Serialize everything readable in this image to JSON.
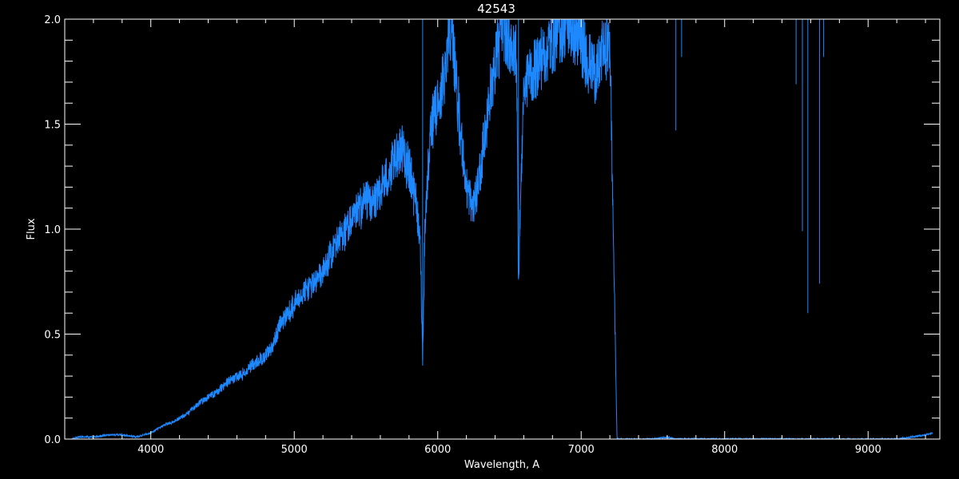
{
  "chart_data": {
    "type": "line",
    "title": "42543",
    "xlabel": "Wavelength, A",
    "ylabel": "Flux",
    "xlim": [
      3400,
      9500
    ],
    "ylim": [
      0,
      2
    ],
    "grid": false,
    "x_ticks": [
      4000,
      5000,
      6000,
      7000,
      8000,
      9000
    ],
    "x_tick_labels": [
      "4000",
      "5000",
      "6000",
      "7000",
      "8000",
      "9000"
    ],
    "y_ticks": [
      0,
      0.5,
      1.0,
      1.5,
      2.0
    ],
    "y_tick_labels": [
      "0.0",
      "0.5",
      "1.0",
      "1.5",
      "2.0"
    ],
    "colors": {
      "background": "#000000",
      "axes": "#ffffff",
      "series": "#1e88ff"
    },
    "series": [
      {
        "name": "",
        "x": [
          3450,
          3500,
          3600,
          3700,
          3800,
          3900,
          4000,
          4050,
          4100,
          4150,
          4200,
          4250,
          4300,
          4350,
          4400,
          4450,
          4500,
          4550,
          4600,
          4650,
          4700,
          4750,
          4800,
          4850,
          4900,
          4950,
          5000,
          5050,
          5100,
          5150,
          5200,
          5250,
          5300,
          5350,
          5400,
          5450,
          5500,
          5550,
          5600,
          5650,
          5700,
          5750,
          5800,
          5850,
          5880,
          5895,
          5910,
          5950,
          6000,
          6050,
          6080,
          6100,
          6150,
          6200,
          6250,
          6300,
          6350,
          6400,
          6450,
          6500,
          6550,
          6563,
          6600,
          6650,
          6700,
          6750,
          6800,
          6850,
          6900,
          6950,
          7000,
          7050,
          7100,
          7150,
          7200,
          7250,
          7300,
          7400,
          7500,
          7600,
          7650,
          7700,
          7800,
          7900,
          8000,
          8100,
          8200,
          8300,
          8400,
          8450,
          8500,
          8542,
          8600,
          8662,
          8700,
          8800,
          8900,
          9000,
          9100,
          9200,
          9300,
          9400,
          9450
        ],
        "y": [
          0.0,
          0.01,
          0.01,
          0.02,
          0.02,
          0.01,
          0.03,
          0.05,
          0.07,
          0.08,
          0.1,
          0.12,
          0.15,
          0.18,
          0.2,
          0.22,
          0.25,
          0.28,
          0.3,
          0.32,
          0.35,
          0.38,
          0.4,
          0.45,
          0.55,
          0.6,
          0.65,
          0.7,
          0.72,
          0.75,
          0.8,
          0.88,
          0.95,
          1.0,
          1.05,
          1.1,
          1.15,
          1.12,
          1.2,
          1.25,
          1.35,
          1.4,
          1.3,
          1.15,
          0.9,
          0.38,
          1.0,
          1.5,
          1.6,
          1.75,
          2.0,
          1.95,
          1.55,
          1.2,
          1.1,
          1.3,
          1.6,
          1.8,
          2.0,
          1.9,
          1.85,
          0.76,
          1.7,
          1.75,
          1.8,
          1.85,
          1.9,
          1.95,
          2.0,
          1.95,
          1.9,
          1.8,
          1.75,
          1.85,
          1.9,
          0.0,
          0.0,
          0.0,
          0.0,
          0.01,
          0.0,
          0.0,
          0.0,
          0.0,
          0.0,
          0.0,
          0.0,
          0.0,
          0.0,
          0.0,
          0.0,
          0.0,
          0.0,
          0.0,
          0.0,
          0.0,
          0.0,
          0.0,
          0.0,
          0.0,
          0.01,
          0.02,
          0.03
        ]
      }
    ],
    "absorption_lines": [
      {
        "x": 5895,
        "ymin": 0.38
      },
      {
        "x": 6563,
        "ymin": 0.76
      },
      {
        "x": 7660,
        "ymin": 1.47
      },
      {
        "x": 7700,
        "ymin": 1.82
      },
      {
        "x": 8498,
        "ymin": 1.69
      },
      {
        "x": 8542,
        "ymin": 0.99
      },
      {
        "x": 8580,
        "ymin": 0.6
      },
      {
        "x": 8662,
        "ymin": 0.74
      },
      {
        "x": 8690,
        "ymin": 1.82
      }
    ]
  }
}
